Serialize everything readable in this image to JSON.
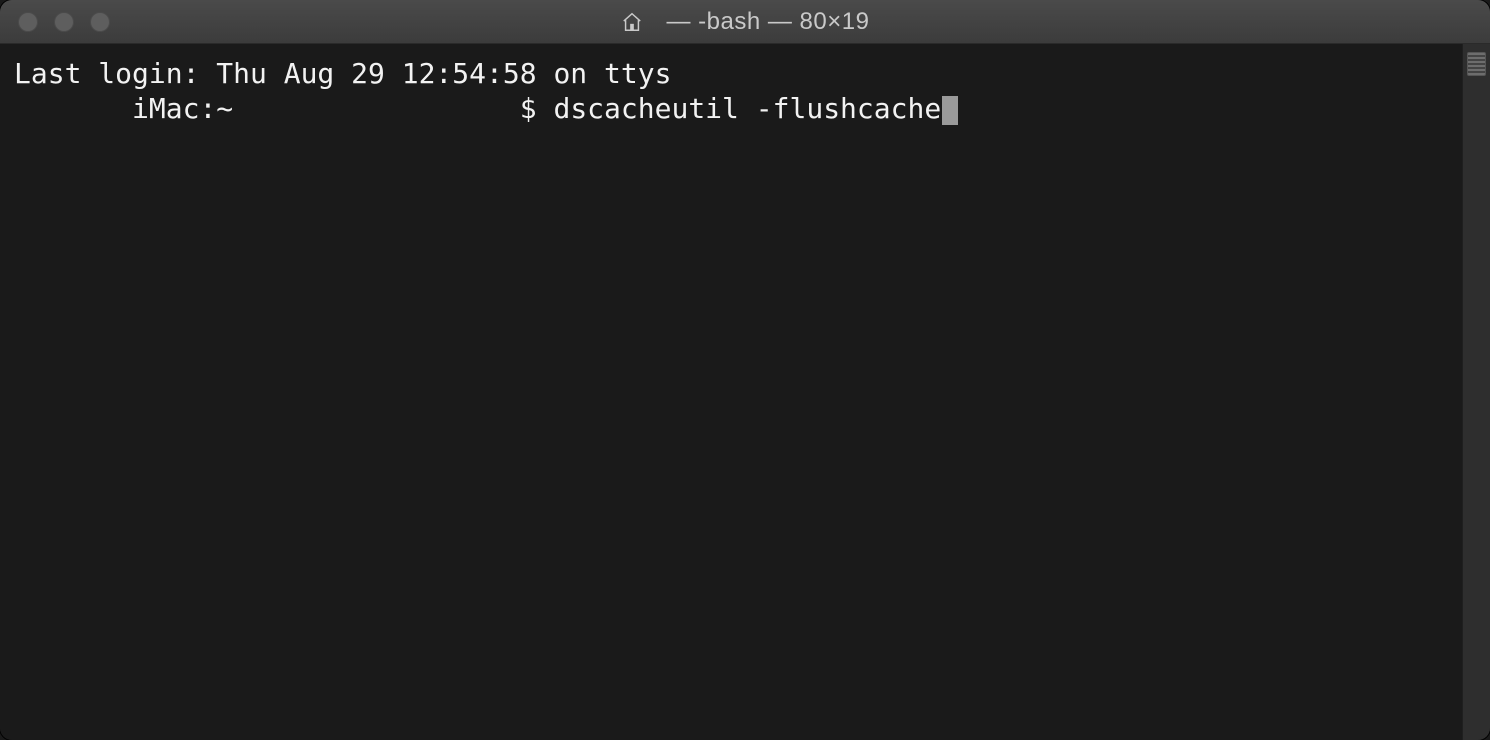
{
  "window": {
    "title": "— -bash — 80×19"
  },
  "terminal": {
    "last_login_line": "Last login: Thu Aug 29 12:54:58 on ttys",
    "prompt_prefix_spaces": "       ",
    "prompt_host": "iMac:~",
    "prompt_gap": "                 ",
    "prompt_symbol": "$ ",
    "command": "dscacheutil -flushcache"
  },
  "colors": {
    "bg": "#1a1a1a",
    "fg": "#f2f2f2",
    "titlebar_text": "#c9c9c9",
    "traffic_inactive": "#5e5e5e"
  }
}
